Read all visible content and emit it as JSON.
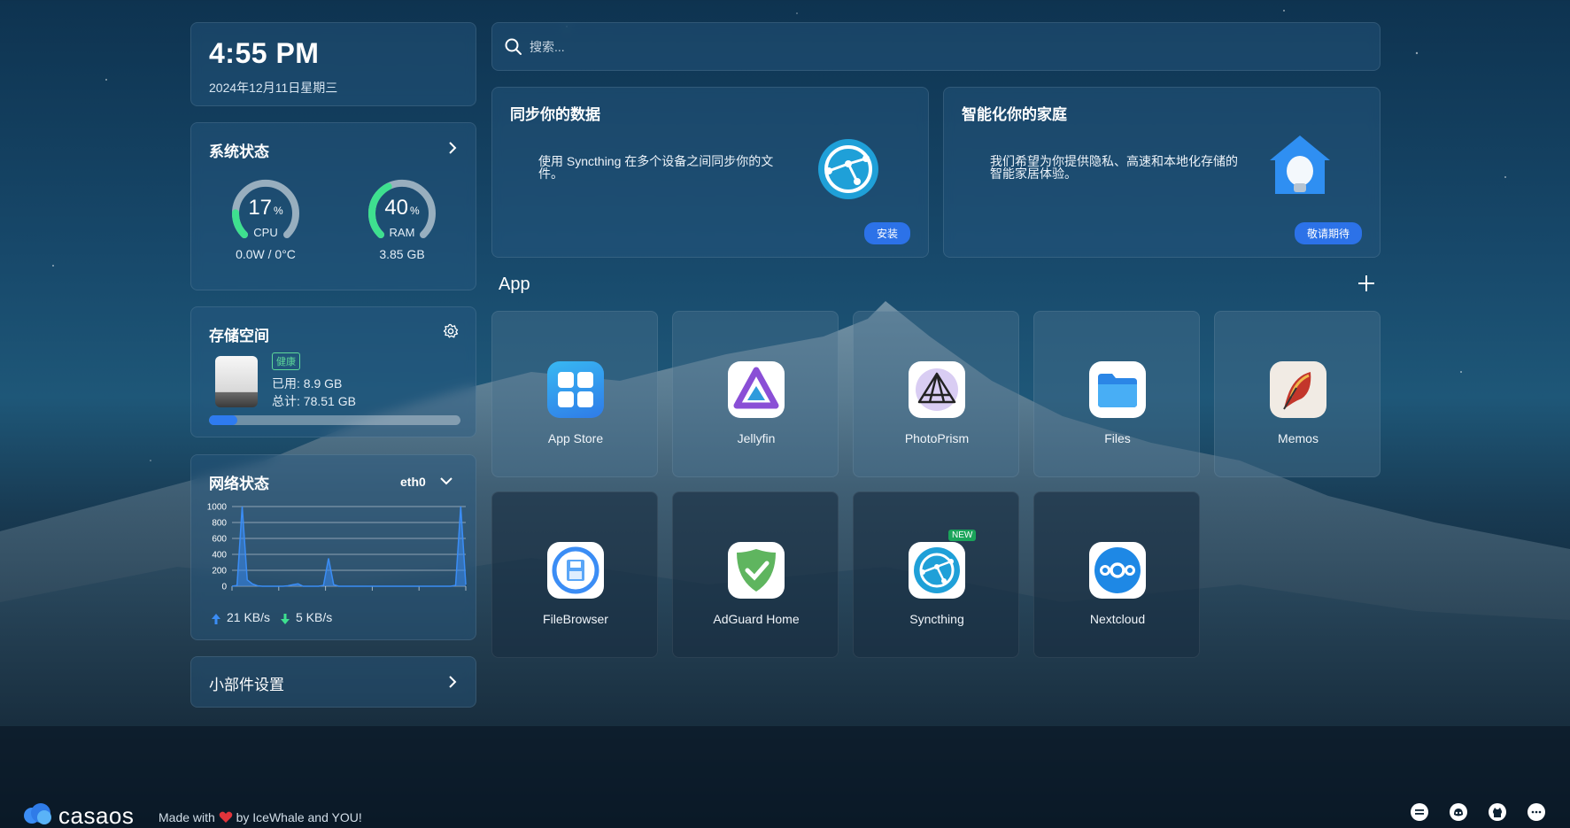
{
  "clock": {
    "time": "4:55 PM",
    "date": "2024年12月11日星期三"
  },
  "system": {
    "title": "系统状态",
    "cpu": {
      "percent": 17,
      "unit": "%",
      "label": "CPU",
      "detail": "0.0W / 0°C"
    },
    "ram": {
      "percent": 40,
      "unit": "%",
      "label": "RAM",
      "detail": "3.85 GB"
    }
  },
  "storage": {
    "title": "存储空间",
    "badge": "健康",
    "used": "已用: 8.9 GB",
    "total": "总计: 78.51 GB",
    "used_fraction": 0.113
  },
  "network": {
    "title": "网络状态",
    "interface": "eth0",
    "chart_data": {
      "type": "area",
      "y_ticks": [
        "1000",
        "800",
        "600",
        "400",
        "200",
        "0"
      ],
      "ylim": [
        0,
        1000
      ],
      "values": [
        0,
        10,
        1000,
        80,
        30,
        5,
        0,
        0,
        0,
        0,
        0,
        5,
        20,
        30,
        0,
        0,
        0,
        0,
        10,
        350,
        20,
        0,
        0,
        0,
        0,
        0,
        0,
        0,
        0,
        0,
        0,
        0,
        0,
        0,
        0,
        0,
        0,
        0,
        0,
        0,
        0,
        0,
        0,
        0,
        10,
        1000,
        20
      ]
    },
    "upload": "21 KB/s",
    "download": "5 KB/s"
  },
  "widgets": {
    "label": "小部件设置"
  },
  "search": {
    "placeholder": "搜索..."
  },
  "promo1": {
    "title": "同步你的数据",
    "description": "使用 Syncthing 在多个设备之间同步你的文件。",
    "button": "安装"
  },
  "promo2": {
    "title": "智能化你的家庭",
    "description": "我们希望为你提供隐私、高速和本地化存储的智能家居体验。",
    "button": "敬请期待"
  },
  "apps": {
    "title": "App",
    "items": [
      {
        "name": "App Store"
      },
      {
        "name": "Jellyfin"
      },
      {
        "name": "PhotoPrism"
      },
      {
        "name": "Files"
      },
      {
        "name": "Memos"
      },
      {
        "name": "FileBrowser"
      },
      {
        "name": "AdGuard Home"
      },
      {
        "name": "Syncthing"
      },
      {
        "name": "Nextcloud"
      }
    ],
    "new_badge": "NEW"
  },
  "footer": {
    "logo": "casaos",
    "made_prefix": "Made with",
    "made_suffix": "by IceWhale and YOU!"
  }
}
